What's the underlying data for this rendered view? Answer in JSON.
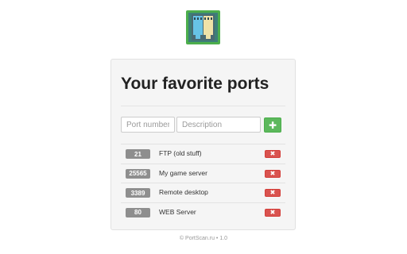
{
  "header": {
    "logo_icon": "port-patch-panel-icon"
  },
  "panel": {
    "title": "Your favorite ports"
  },
  "form": {
    "port_placeholder": "Port number",
    "port_value": "",
    "description_placeholder": "Description",
    "description_value": "",
    "add_icon": "plus-icon",
    "add_glyph": "✚"
  },
  "ports": [
    {
      "port": "21",
      "description": "FTP (old stuff)",
      "delete_glyph": "✖"
    },
    {
      "port": "25565",
      "description": "My game server",
      "delete_glyph": "✖"
    },
    {
      "port": "3389",
      "description": "Remote desktop",
      "delete_glyph": "✖"
    },
    {
      "port": "80",
      "description": "WEB Server",
      "delete_glyph": "✖"
    }
  ],
  "footer": {
    "text": "© PortScan.ru • 1.0"
  },
  "colors": {
    "add_button": "#5cb85c",
    "delete_button": "#d9534f",
    "port_badge": "#8e8e8e",
    "panel_bg": "#f5f5f5"
  }
}
